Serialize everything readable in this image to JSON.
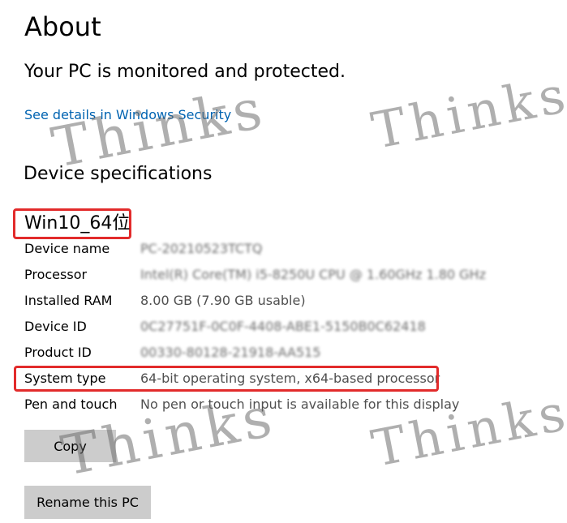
{
  "page": {
    "title": "About",
    "protection_status": "Your PC is monitored and protected.",
    "security_link": "See details in Windows Security",
    "section_title": "Device specifications"
  },
  "annotation": {
    "os_label": "Win10_64位",
    "highlight_color": "#e22b2b"
  },
  "specs": [
    {
      "label": "Device name",
      "value": "PC-20210523TCTQ"
    },
    {
      "label": "Processor",
      "value": "Intel(R) Core(TM) i5-8250U CPU @ 1.60GHz   1.80 GHz"
    },
    {
      "label": "Installed RAM",
      "value": "8.00 GB (7.90 GB usable)"
    },
    {
      "label": "Device ID",
      "value": "0C27751F-0C0F-4408-ABE1-5150B0C62418"
    },
    {
      "label": "Product ID",
      "value": "00330-80128-21918-AA515"
    },
    {
      "label": "System type",
      "value": "64-bit operating system, x64-based processor"
    },
    {
      "label": "Pen and touch",
      "value": "No pen or touch input is available for this display"
    }
  ],
  "buttons": {
    "copy": "Copy",
    "rename": "Rename this PC"
  },
  "watermark": {
    "text": "Thinks"
  },
  "colors": {
    "link": "#0063b1",
    "button_bg": "#cccccc",
    "value_text": "#505050"
  }
}
